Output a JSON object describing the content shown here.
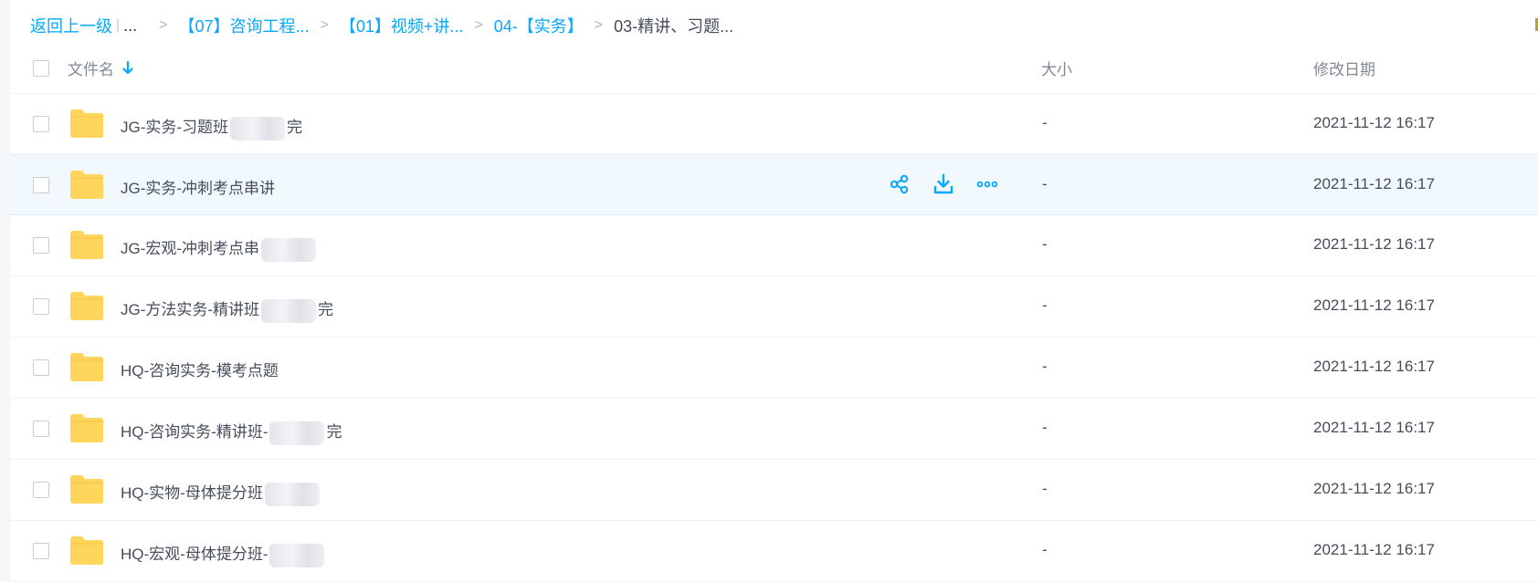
{
  "breadcrumb": {
    "back_label": "返回上一级",
    "ellipsis": "...",
    "separator": ">",
    "crumbs": [
      "【07】咨询工程...",
      "【01】视频+讲...",
      "04-【实务】"
    ],
    "current": "03-精讲、习题..."
  },
  "columns": {
    "name": "文件名",
    "size": "大小",
    "date": "修改日期"
  },
  "accent_color": "#06a7ff",
  "folder_color": "#ffd55c",
  "rows": [
    {
      "name_a": "JG-实务-习题班",
      "name_b": "完",
      "size": "-",
      "date": "2021-11-12 16:17"
    },
    {
      "name_a": "JG-实务-冲刺考点串讲",
      "name_b": "",
      "size": "-",
      "date": "2021-11-12 16:17"
    },
    {
      "name_a": "JG-宏观-冲刺考点串",
      "name_b": "",
      "size": "-",
      "date": "2021-11-12 16:17"
    },
    {
      "name_a": "JG-方法实务-精讲班",
      "name_b": "完",
      "size": "-",
      "date": "2021-11-12 16:17"
    },
    {
      "name_a": "HQ-咨询实务-模考点题",
      "name_b": "",
      "size": "-",
      "date": "2021-11-12 16:17"
    },
    {
      "name_a": "HQ-咨询实务-精讲班-",
      "name_b": "完",
      "size": "-",
      "date": "2021-11-12 16:17"
    },
    {
      "name_a": "HQ-实物-母体提分班",
      "name_b": "",
      "size": "-",
      "date": "2021-11-12 16:17"
    },
    {
      "name_a": "HQ-宏观-母体提分班-",
      "name_b": "",
      "size": "-",
      "date": "2021-11-12 16:17"
    }
  ]
}
